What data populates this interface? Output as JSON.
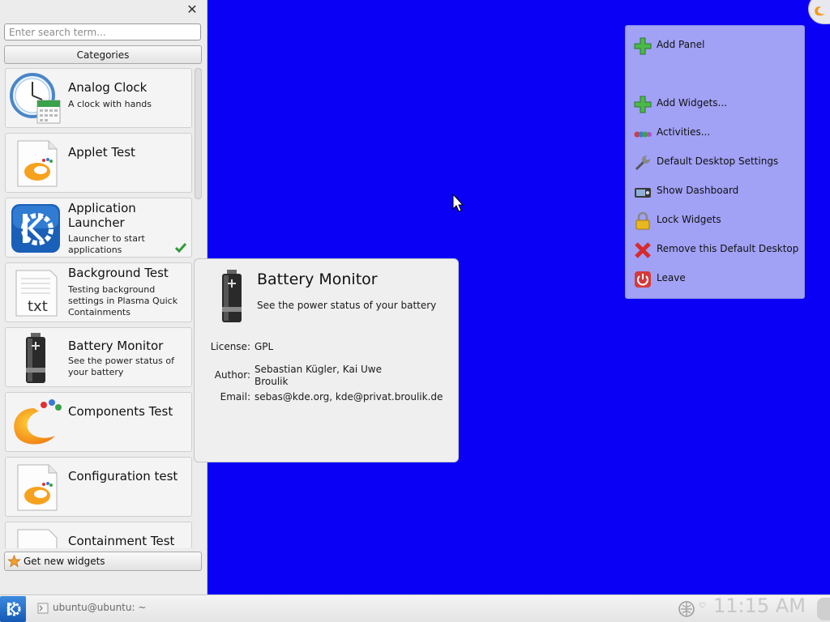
{
  "sidebar": {
    "close_glyph": "✕",
    "search": {
      "placeholder": "Enter search term...",
      "value": ""
    },
    "categories_label": "Categories",
    "items": [
      {
        "name": "Analog Clock",
        "description": "A clock with hands",
        "icon": "analog-clock-icon",
        "installed": false
      },
      {
        "name": "Applet Test",
        "description": "",
        "icon": "applet-test-icon",
        "installed": false
      },
      {
        "name": "Application Launcher",
        "description": "Launcher to start applications",
        "icon": "kde-launcher-icon",
        "installed": true
      },
      {
        "name": "Background Test",
        "description": "Testing background settings in Plasma Quick Containments",
        "icon": "text-document-icon",
        "installed": false
      },
      {
        "name": "Battery Monitor",
        "description": "See the power status of your battery",
        "icon": "battery-icon",
        "installed": false
      },
      {
        "name": "Components Test",
        "description": "",
        "icon": "plasma-logo-icon",
        "installed": false
      },
      {
        "name": "Configuration test",
        "description": "",
        "icon": "configuration-test-icon",
        "installed": false
      },
      {
        "name": "Containment Test",
        "description": "",
        "icon": "containment-test-icon",
        "installed": false
      }
    ],
    "get_new_label": "Get new widgets"
  },
  "tooltip": {
    "title": "Battery Monitor",
    "description": "See the power status of your battery",
    "license_label": "License:",
    "license_value": "GPL",
    "author_label": "Author:",
    "author_value": "Sebastian Kügler, Kai Uwe Broulik",
    "email_label": "Email:",
    "email_value": "sebas@kde.org, kde@privat.broulik.de"
  },
  "context_menu": {
    "items": [
      {
        "label": "Add Panel",
        "icon": "add-icon"
      },
      {
        "label": "Add Widgets...",
        "icon": "add-icon"
      },
      {
        "label": "Activities...",
        "icon": "activities-icon"
      },
      {
        "label": "Default Desktop Settings",
        "icon": "wrench-icon"
      },
      {
        "label": "Show Dashboard",
        "icon": "dashboard-icon"
      },
      {
        "label": "Lock Widgets",
        "icon": "lock-icon"
      },
      {
        "label": "Remove this Default Desktop",
        "icon": "remove-icon"
      },
      {
        "label": "Leave",
        "icon": "power-icon"
      }
    ]
  },
  "taskbar": {
    "task_label": "ubuntu@ubuntu: ~",
    "clock": "11:15 AM",
    "tray_arrow": "♡"
  },
  "colors": {
    "desktop": "#0a00f5",
    "menu": "#a1a1f6",
    "panel": "#ececec"
  }
}
